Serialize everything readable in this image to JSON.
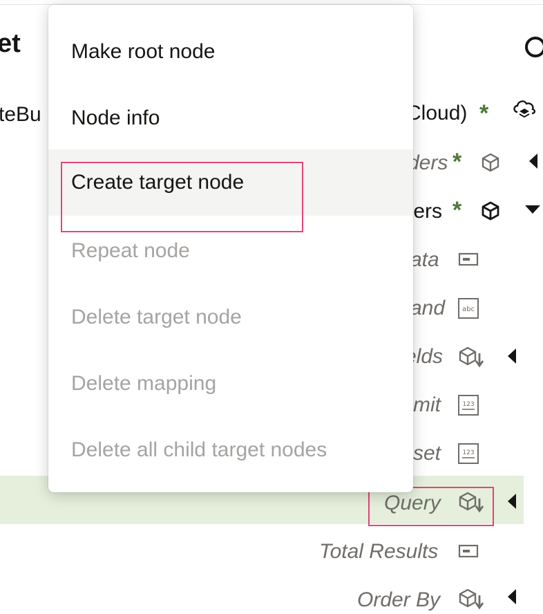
{
  "header": {
    "title_fragment": "et"
  },
  "tree": {
    "row1": "teBu",
    "cloud_node": {
      "label": "Cloud)",
      "icon": "cloud-stack-icon"
    },
    "nodes": [
      {
        "label": "ders",
        "icon": "cube-outline-icon",
        "expander": "collapsed"
      },
      {
        "label": "ters",
        "icon": "cube-outline-icon",
        "expander": "expanded"
      },
      {
        "label": "ata",
        "icon": "text-field-icon"
      },
      {
        "label": "and",
        "icon": "abc-icon",
        "icon_text": "abc"
      },
      {
        "label": "elds",
        "icon": "cube-array-icon",
        "expander": "collapsed"
      },
      {
        "label": "mit",
        "icon": "number-icon",
        "icon_text": "123"
      },
      {
        "label": "set",
        "icon": "number-icon",
        "icon_text": "123"
      },
      {
        "label": "Query",
        "icon": "cube-array-icon",
        "expander": "collapsed",
        "selected": true
      },
      {
        "label": "Total Results",
        "icon": "text-field-icon"
      },
      {
        "label": "Order By",
        "icon": "cube-array-icon",
        "expander": "collapsed"
      }
    ],
    "modified_marker": "*"
  },
  "context_menu": {
    "items": [
      {
        "label": "Make root node",
        "enabled": true
      },
      {
        "label": "Node info",
        "enabled": true
      },
      {
        "label": "Create target node",
        "enabled": true,
        "hovered": true
      },
      {
        "label": "Repeat node",
        "enabled": false
      },
      {
        "label": "Delete target node",
        "enabled": false
      },
      {
        "label": "Delete mapping",
        "enabled": false
      },
      {
        "label": "Delete all child target nodes",
        "enabled": false
      }
    ]
  },
  "colors": {
    "selected_row": "#e5efdc",
    "highlight_outline": "#e3447a",
    "modified_star": "#4b7a38",
    "disabled_text": "#a6a3a1"
  }
}
